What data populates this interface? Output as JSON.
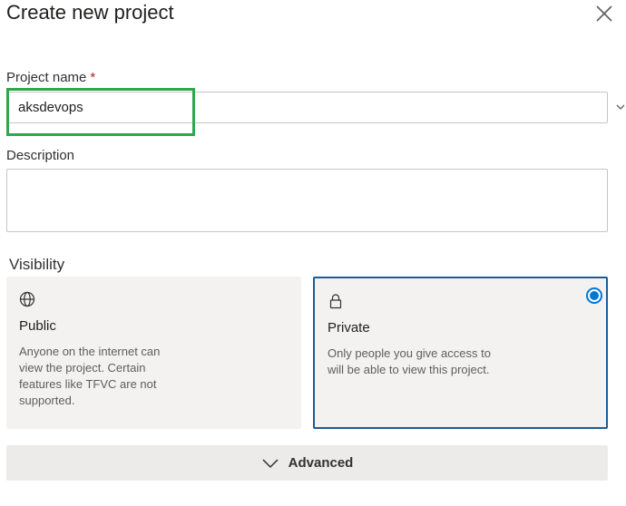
{
  "dialog": {
    "title": "Create new project",
    "close_icon": "close-icon"
  },
  "project_name": {
    "label": "Project name",
    "required_marker": "*",
    "value": "aksdevops"
  },
  "description": {
    "label": "Description",
    "value": ""
  },
  "visibility": {
    "label": "Visibility",
    "options": [
      {
        "icon": "globe-icon",
        "title": "Public",
        "description": "Anyone on the internet can view the project. Certain features like TFVC are not supported.",
        "selected": false
      },
      {
        "icon": "lock-icon",
        "title": "Private",
        "description": "Only people you give access to will be able to view this project.",
        "selected": true
      }
    ]
  },
  "advanced": {
    "label": "Advanced",
    "icon": "chevron-down-icon"
  },
  "colors": {
    "highlight": "#2ea84a",
    "selected_border": "#1a5c97",
    "accent": "#0078d4"
  }
}
